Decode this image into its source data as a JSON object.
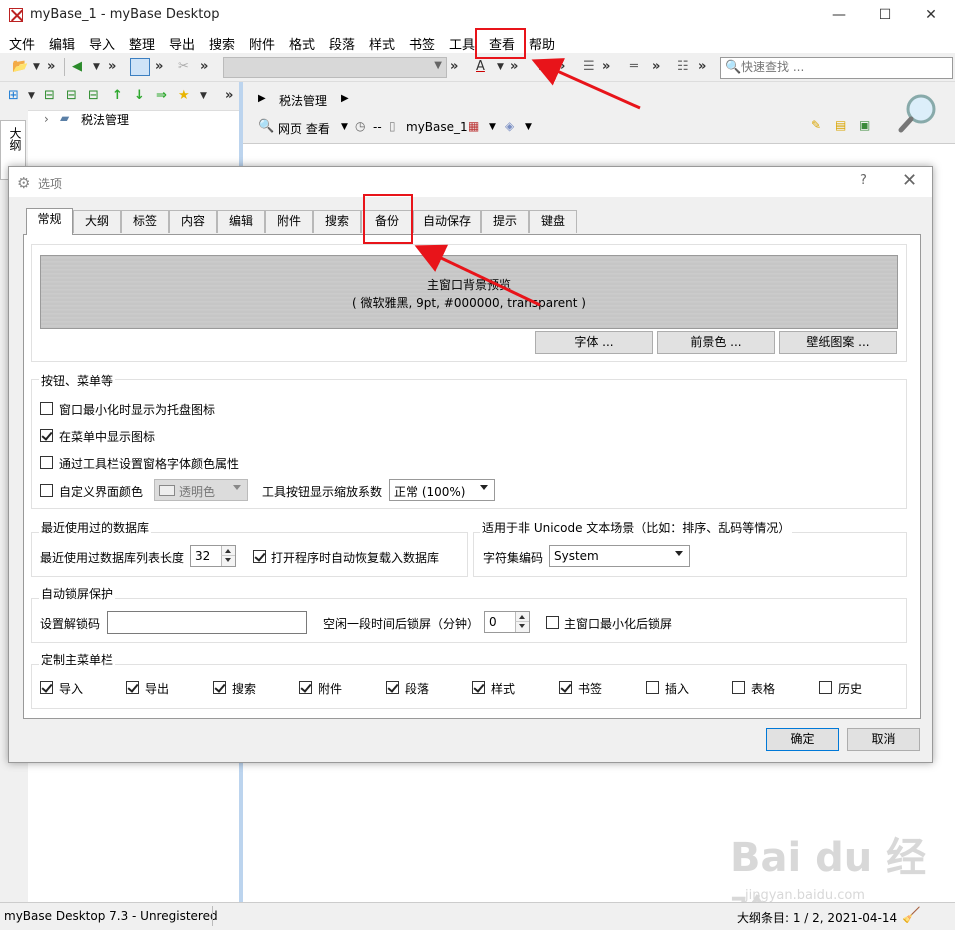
{
  "window": {
    "title": "myBase_1 - myBase Desktop",
    "controls": {
      "minimize": "—",
      "maximize": "☐",
      "close": "✕"
    }
  },
  "menubar": [
    "文件",
    "编辑",
    "导入",
    "整理",
    "导出",
    "搜索",
    "附件",
    "格式",
    "段落",
    "样式",
    "书签",
    "工具",
    "查看",
    "帮助"
  ],
  "toolbar": {
    "quick_find_placeholder": "快速查找 ..."
  },
  "left_panel": {
    "side_tab": "大纲",
    "tree_root": "税法管理"
  },
  "right_panel": {
    "breadcrumb": "税法管理",
    "view_mode": "网页 查看",
    "db_prefix": "--",
    "db_name": "myBase_1"
  },
  "dialog": {
    "title": "选项",
    "help": "?",
    "close": "✕",
    "tabs": [
      "常规",
      "大纲",
      "标签",
      "内容",
      "编辑",
      "附件",
      "搜索",
      "备份",
      "自动保存",
      "提示",
      "键盘"
    ],
    "active_tab": "常规",
    "preview": {
      "line1": "主窗口背景预览",
      "line2": "( 微软雅黑, 9pt, #000000, transparent )"
    },
    "preview_buttons": [
      "字体 ...",
      "前景色 ...",
      "壁纸图案 ..."
    ],
    "group_buttons": {
      "title": "按钮、菜单等",
      "opt_tray": {
        "label": "窗口最小化时显示为托盘图标",
        "checked": false
      },
      "opt_menu_icons": {
        "label": "在菜单中显示图标",
        "checked": true
      },
      "opt_toolbar_font": {
        "label": "通过工具栏设置窗格字体颜色属性",
        "checked": false
      },
      "opt_custom_color": {
        "label": "自定义界面颜色",
        "checked": false
      },
      "color_combo": "透明色",
      "scale_label": "工具按钮显示缩放系数",
      "scale_value": "正常 (100%)"
    },
    "group_recent": {
      "title": "最近使用过的数据库",
      "list_len_label": "最近使用过数据库列表长度",
      "list_len_value": "32",
      "auto_reload": {
        "label": "打开程序时自动恢复载入数据库",
        "checked": true
      }
    },
    "group_charset": {
      "title": "适用于非 Unicode 文本场景（比如：排序、乱码等情况）",
      "label": "字符集编码",
      "value": "System"
    },
    "group_lock": {
      "title": "自动锁屏保护",
      "pwd_label": "设置解锁码",
      "idle_label": "空闲一段时间后锁屏（分钟）",
      "idle_value": "0",
      "lock_min": {
        "label": "主窗口最小化后锁屏",
        "checked": false
      }
    },
    "group_menubar": {
      "title": "定制主菜单栏",
      "items": [
        {
          "label": "导入",
          "checked": true
        },
        {
          "label": "导出",
          "checked": true
        },
        {
          "label": "搜索",
          "checked": true
        },
        {
          "label": "附件",
          "checked": true
        },
        {
          "label": "段落",
          "checked": true
        },
        {
          "label": "样式",
          "checked": true
        },
        {
          "label": "书签",
          "checked": true
        },
        {
          "label": "插入",
          "checked": false
        },
        {
          "label": "表格",
          "checked": false
        },
        {
          "label": "历史",
          "checked": false
        }
      ]
    },
    "ok": "确定",
    "cancel": "取消"
  },
  "statusbar": {
    "left": "myBase Desktop 7.3 - Unregistered",
    "right": "大纲条目: 1 / 2, 2021-04-14"
  },
  "watermark": {
    "logo": "Bai du 经验",
    "url": "jingyan.baidu.com"
  },
  "annotation_color": "#e8141a"
}
